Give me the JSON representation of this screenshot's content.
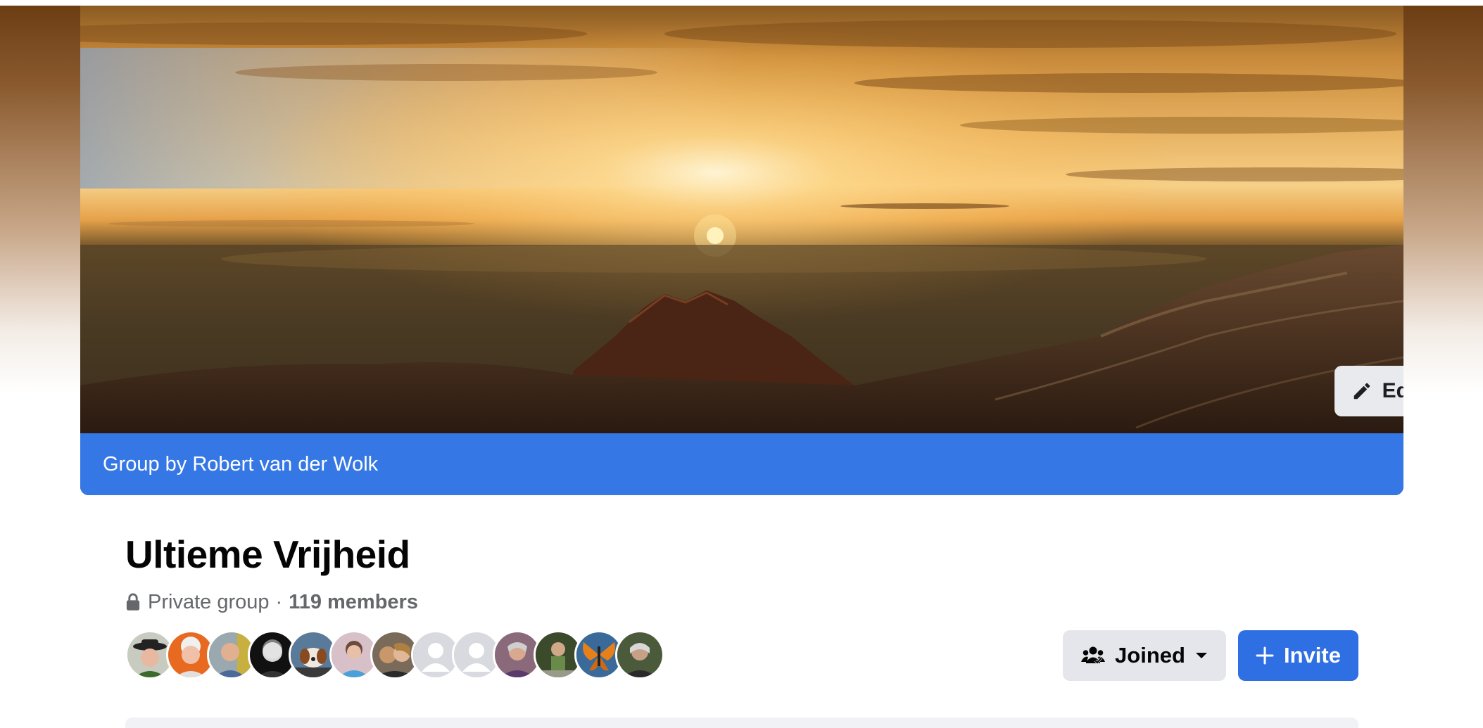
{
  "cover": {
    "edit_label": "Edit",
    "group_by_text": "Group by Robert van der Wolk"
  },
  "group": {
    "name": "Ultieme Vrijheid",
    "privacy": "Private group",
    "separator": "·",
    "members": "119 members"
  },
  "avatars": [
    {
      "name": "member-1"
    },
    {
      "name": "member-2"
    },
    {
      "name": "member-3"
    },
    {
      "name": "member-4"
    },
    {
      "name": "member-5"
    },
    {
      "name": "member-6"
    },
    {
      "name": "member-7"
    },
    {
      "name": "member-8-default"
    },
    {
      "name": "member-9-default"
    },
    {
      "name": "member-10"
    },
    {
      "name": "member-11"
    },
    {
      "name": "member-12"
    },
    {
      "name": "member-13"
    }
  ],
  "actions": {
    "joined_label": "Joined",
    "invite_label": "Invite"
  },
  "colors": {
    "brand_blue": "#3578e5",
    "button_gray": "#e4e6eb",
    "text_secondary": "#65676b"
  }
}
